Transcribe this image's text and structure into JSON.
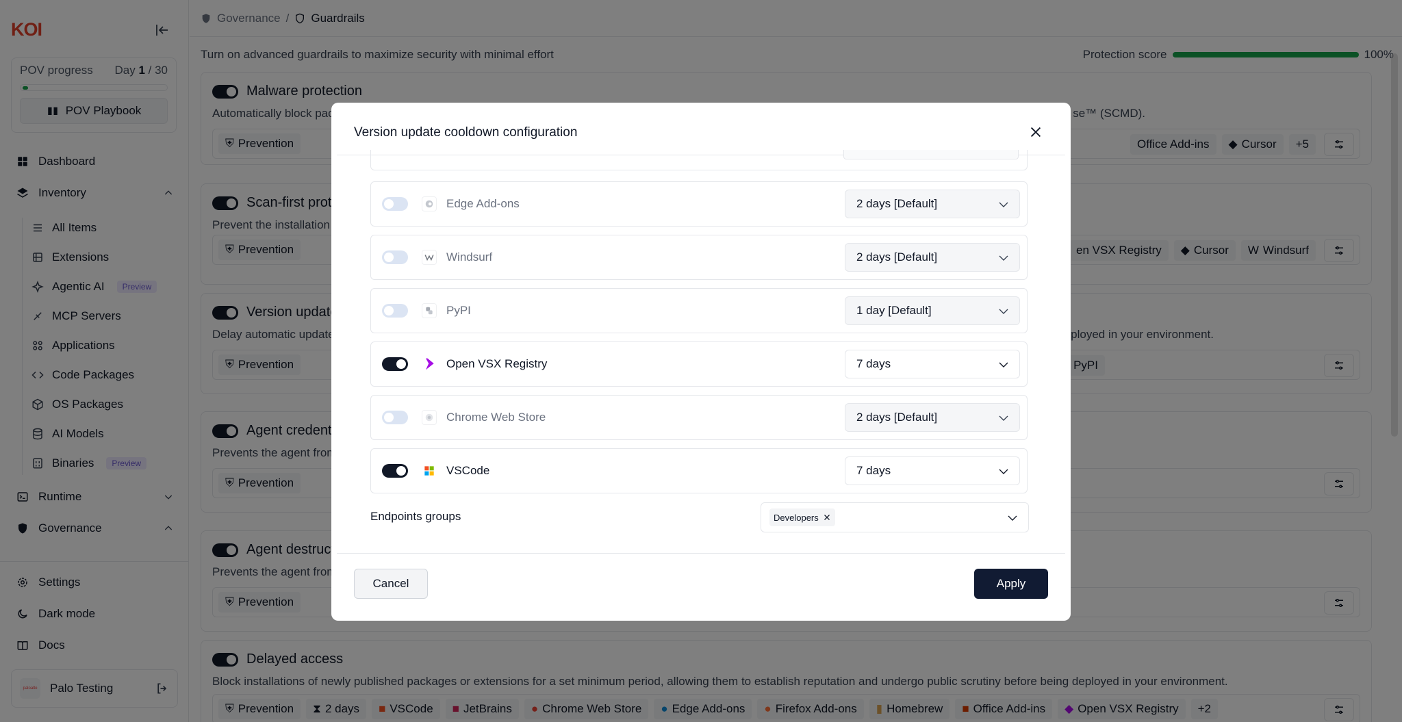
{
  "app": {
    "logo": "KOI"
  },
  "sidebar": {
    "pov": {
      "label": "POV progress",
      "day_prefix": "Day ",
      "day_current": "1",
      "day_total": " / 30",
      "progress_fraction": 0.033,
      "playbook_label": "POV Playbook"
    },
    "items": [
      {
        "label": "Dashboard"
      },
      {
        "label": "Inventory"
      },
      {
        "label": "Runtime"
      },
      {
        "label": "Governance"
      }
    ],
    "inventory_items": [
      {
        "label": "All Items"
      },
      {
        "label": "Extensions"
      },
      {
        "label": "Agentic AI",
        "badge": "Preview"
      },
      {
        "label": "MCP Servers"
      },
      {
        "label": "Applications"
      },
      {
        "label": "Code Packages"
      },
      {
        "label": "OS Packages"
      },
      {
        "label": "AI Models"
      },
      {
        "label": "Binaries",
        "badge": "Preview"
      }
    ],
    "bottom": [
      {
        "label": "Settings"
      },
      {
        "label": "Dark mode"
      },
      {
        "label": "Docs"
      }
    ],
    "user": {
      "name": "Palo Testing",
      "avatar_text": "paloalto"
    }
  },
  "breadcrumb": {
    "parent": "Governance",
    "separator": "/",
    "current": "Guardrails"
  },
  "page": {
    "subtitle": "Turn on advanced guardrails to maximize security with minimal effort",
    "protection_label": "Protection score",
    "protection_value": "100%",
    "protection_fraction": 1.0
  },
  "cards": [
    {
      "title": "Malware protection",
      "desc_left": "Automatically block pac",
      "desc_right": "se™ (SCMD).",
      "tag_left": "Prevention",
      "tags_right": [
        "Office Add-ins",
        "Cursor",
        "+5"
      ]
    },
    {
      "title": "Scan-first prote",
      "desc_left": "Prevent the installation c",
      "desc_right": "",
      "tag_left": "Prevention",
      "tags_right": [
        "en VSX Registry",
        "Cursor",
        "Windsurf"
      ]
    },
    {
      "title": "Version update",
      "desc_left": "Delay automatic update",
      "desc_right": "eployed in your environment.",
      "tag_left": "Prevention",
      "tags_right": [
        "PyPI"
      ]
    },
    {
      "title": "Agent credentia",
      "desc_left": "Prevents the agent from",
      "desc_right": "",
      "tag_left": "Prevention",
      "tags_right": []
    },
    {
      "title": "Agent destructi",
      "desc_left": "Prevents the agent from",
      "desc_right": "",
      "tag_left": "Prevention",
      "tags_right": []
    }
  ],
  "delayed": {
    "title": "Delayed access",
    "desc": "Block installations of newly published packages or extensions for a set minimum period, allowing them to establish reputation and undergo public scrutiny before being deployed in your environment.",
    "tags": [
      "Prevention",
      "2 days",
      "VSCode",
      "JetBrains",
      "Chrome Web Store",
      "Edge Add-ons",
      "Firefox Add-ons",
      "Homebrew",
      "Office Add-ins",
      "Open VSX Registry",
      "+2"
    ]
  },
  "modal": {
    "title": "Version update cooldown configuration",
    "registries": [
      {
        "name": "Edge Add-ons",
        "enabled": false,
        "value": "2 days [Default]",
        "icon": "edge-icon"
      },
      {
        "name": "Windsurf",
        "enabled": false,
        "value": "2 days [Default]",
        "icon": "windsurf-icon"
      },
      {
        "name": "PyPI",
        "enabled": false,
        "value": "1 day [Default]",
        "icon": "pypi-icon"
      },
      {
        "name": "Open VSX Registry",
        "enabled": true,
        "value": "7 days",
        "icon": "openvsx-icon"
      },
      {
        "name": "Chrome Web Store",
        "enabled": false,
        "value": "2 days [Default]",
        "icon": "chrome-icon"
      },
      {
        "name": "VSCode",
        "enabled": true,
        "value": "7 days",
        "icon": "vscode-icon"
      }
    ],
    "endpoints_label": "Endpoints groups",
    "endpoints_chip": "Developers",
    "cancel_label": "Cancel",
    "apply_label": "Apply"
  },
  "colors": {
    "accent_dark": "#111b33",
    "logo_red": "#e0402a",
    "success_green": "#16a34a",
    "preview_purple": "#6d5bd0"
  }
}
